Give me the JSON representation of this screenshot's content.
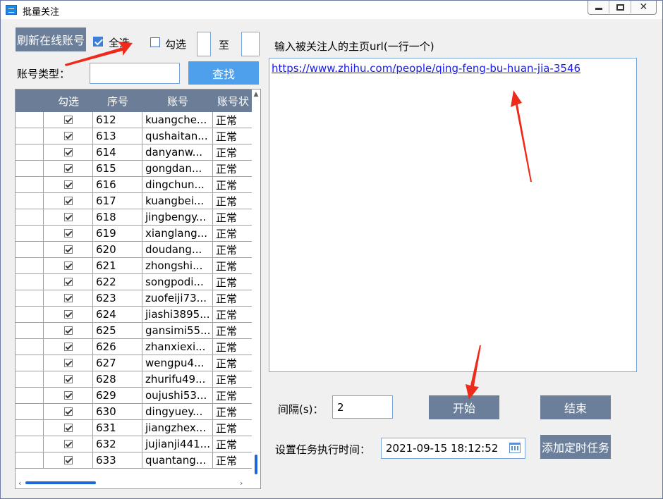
{
  "window": {
    "title": "批量关注"
  },
  "toolbar": {
    "refresh_label": "刷新在线账号",
    "select_all_label": "全选",
    "select_all_checked": true,
    "range_check_label": "勾选",
    "range_check_checked": false,
    "range_to_label": "至",
    "range_from_value": "",
    "range_to_value": "",
    "account_type_label": "账号类型：",
    "account_type_value": "",
    "search_label": "查找"
  },
  "grid": {
    "columns": [
      "",
      "勾选",
      "序号",
      "账号",
      "账号状"
    ],
    "rows": [
      {
        "checked": true,
        "index": "612",
        "account": "kuangche...",
        "status": "正常"
      },
      {
        "checked": true,
        "index": "613",
        "account": "qushaitan...",
        "status": "正常"
      },
      {
        "checked": true,
        "index": "614",
        "account": "danyanw...",
        "status": "正常"
      },
      {
        "checked": true,
        "index": "615",
        "account": "gongdan...",
        "status": "正常"
      },
      {
        "checked": true,
        "index": "616",
        "account": "dingchun...",
        "status": "正常"
      },
      {
        "checked": true,
        "index": "617",
        "account": "kuangbei...",
        "status": "正常"
      },
      {
        "checked": true,
        "index": "618",
        "account": "jingbengy...",
        "status": "正常"
      },
      {
        "checked": true,
        "index": "619",
        "account": "xianglang...",
        "status": "正常"
      },
      {
        "checked": true,
        "index": "620",
        "account": "doudang...",
        "status": "正常"
      },
      {
        "checked": true,
        "index": "621",
        "account": "zhongshi...",
        "status": "正常"
      },
      {
        "checked": true,
        "index": "622",
        "account": "songpodi...",
        "status": "正常"
      },
      {
        "checked": true,
        "index": "623",
        "account": "zuofeiji73...",
        "status": "正常"
      },
      {
        "checked": true,
        "index": "624",
        "account": "jiashi3895...",
        "status": "正常"
      },
      {
        "checked": true,
        "index": "625",
        "account": "gansimi55...",
        "status": "正常"
      },
      {
        "checked": true,
        "index": "626",
        "account": "zhanxiexi...",
        "status": "正常"
      },
      {
        "checked": true,
        "index": "627",
        "account": "wengpu4...",
        "status": "正常"
      },
      {
        "checked": true,
        "index": "628",
        "account": "zhurifu49...",
        "status": "正常"
      },
      {
        "checked": true,
        "index": "629",
        "account": "oujushi53...",
        "status": "正常"
      },
      {
        "checked": true,
        "index": "630",
        "account": "dingyuey...",
        "status": "正常"
      },
      {
        "checked": true,
        "index": "631",
        "account": "jiangzhex...",
        "status": "正常"
      },
      {
        "checked": true,
        "index": "632",
        "account": "jujianji441...",
        "status": "正常"
      },
      {
        "checked": true,
        "index": "633",
        "account": "quantang...",
        "status": "正常"
      }
    ]
  },
  "main": {
    "url_prompt": "输入被关注人的主页url(一行一个)",
    "url_text": "https://www.zhihu.com/people/qing-feng-bu-huan-jia-3546",
    "interval_label": "间隔(s)：",
    "interval_value": "2",
    "start_label": "开始",
    "end_label": "结束",
    "schedule_label": "设置任务执行时间：",
    "schedule_value": "2021-09-15 18:12:52",
    "add_task_label": "添加定时任务"
  },
  "colors": {
    "flat_button": "#6b7f9b",
    "blue_button": "#4ea0ec",
    "grid_header": "#6c7d97",
    "annotation_arrow": "#ee2a1b",
    "link": "#1a1ae6"
  }
}
